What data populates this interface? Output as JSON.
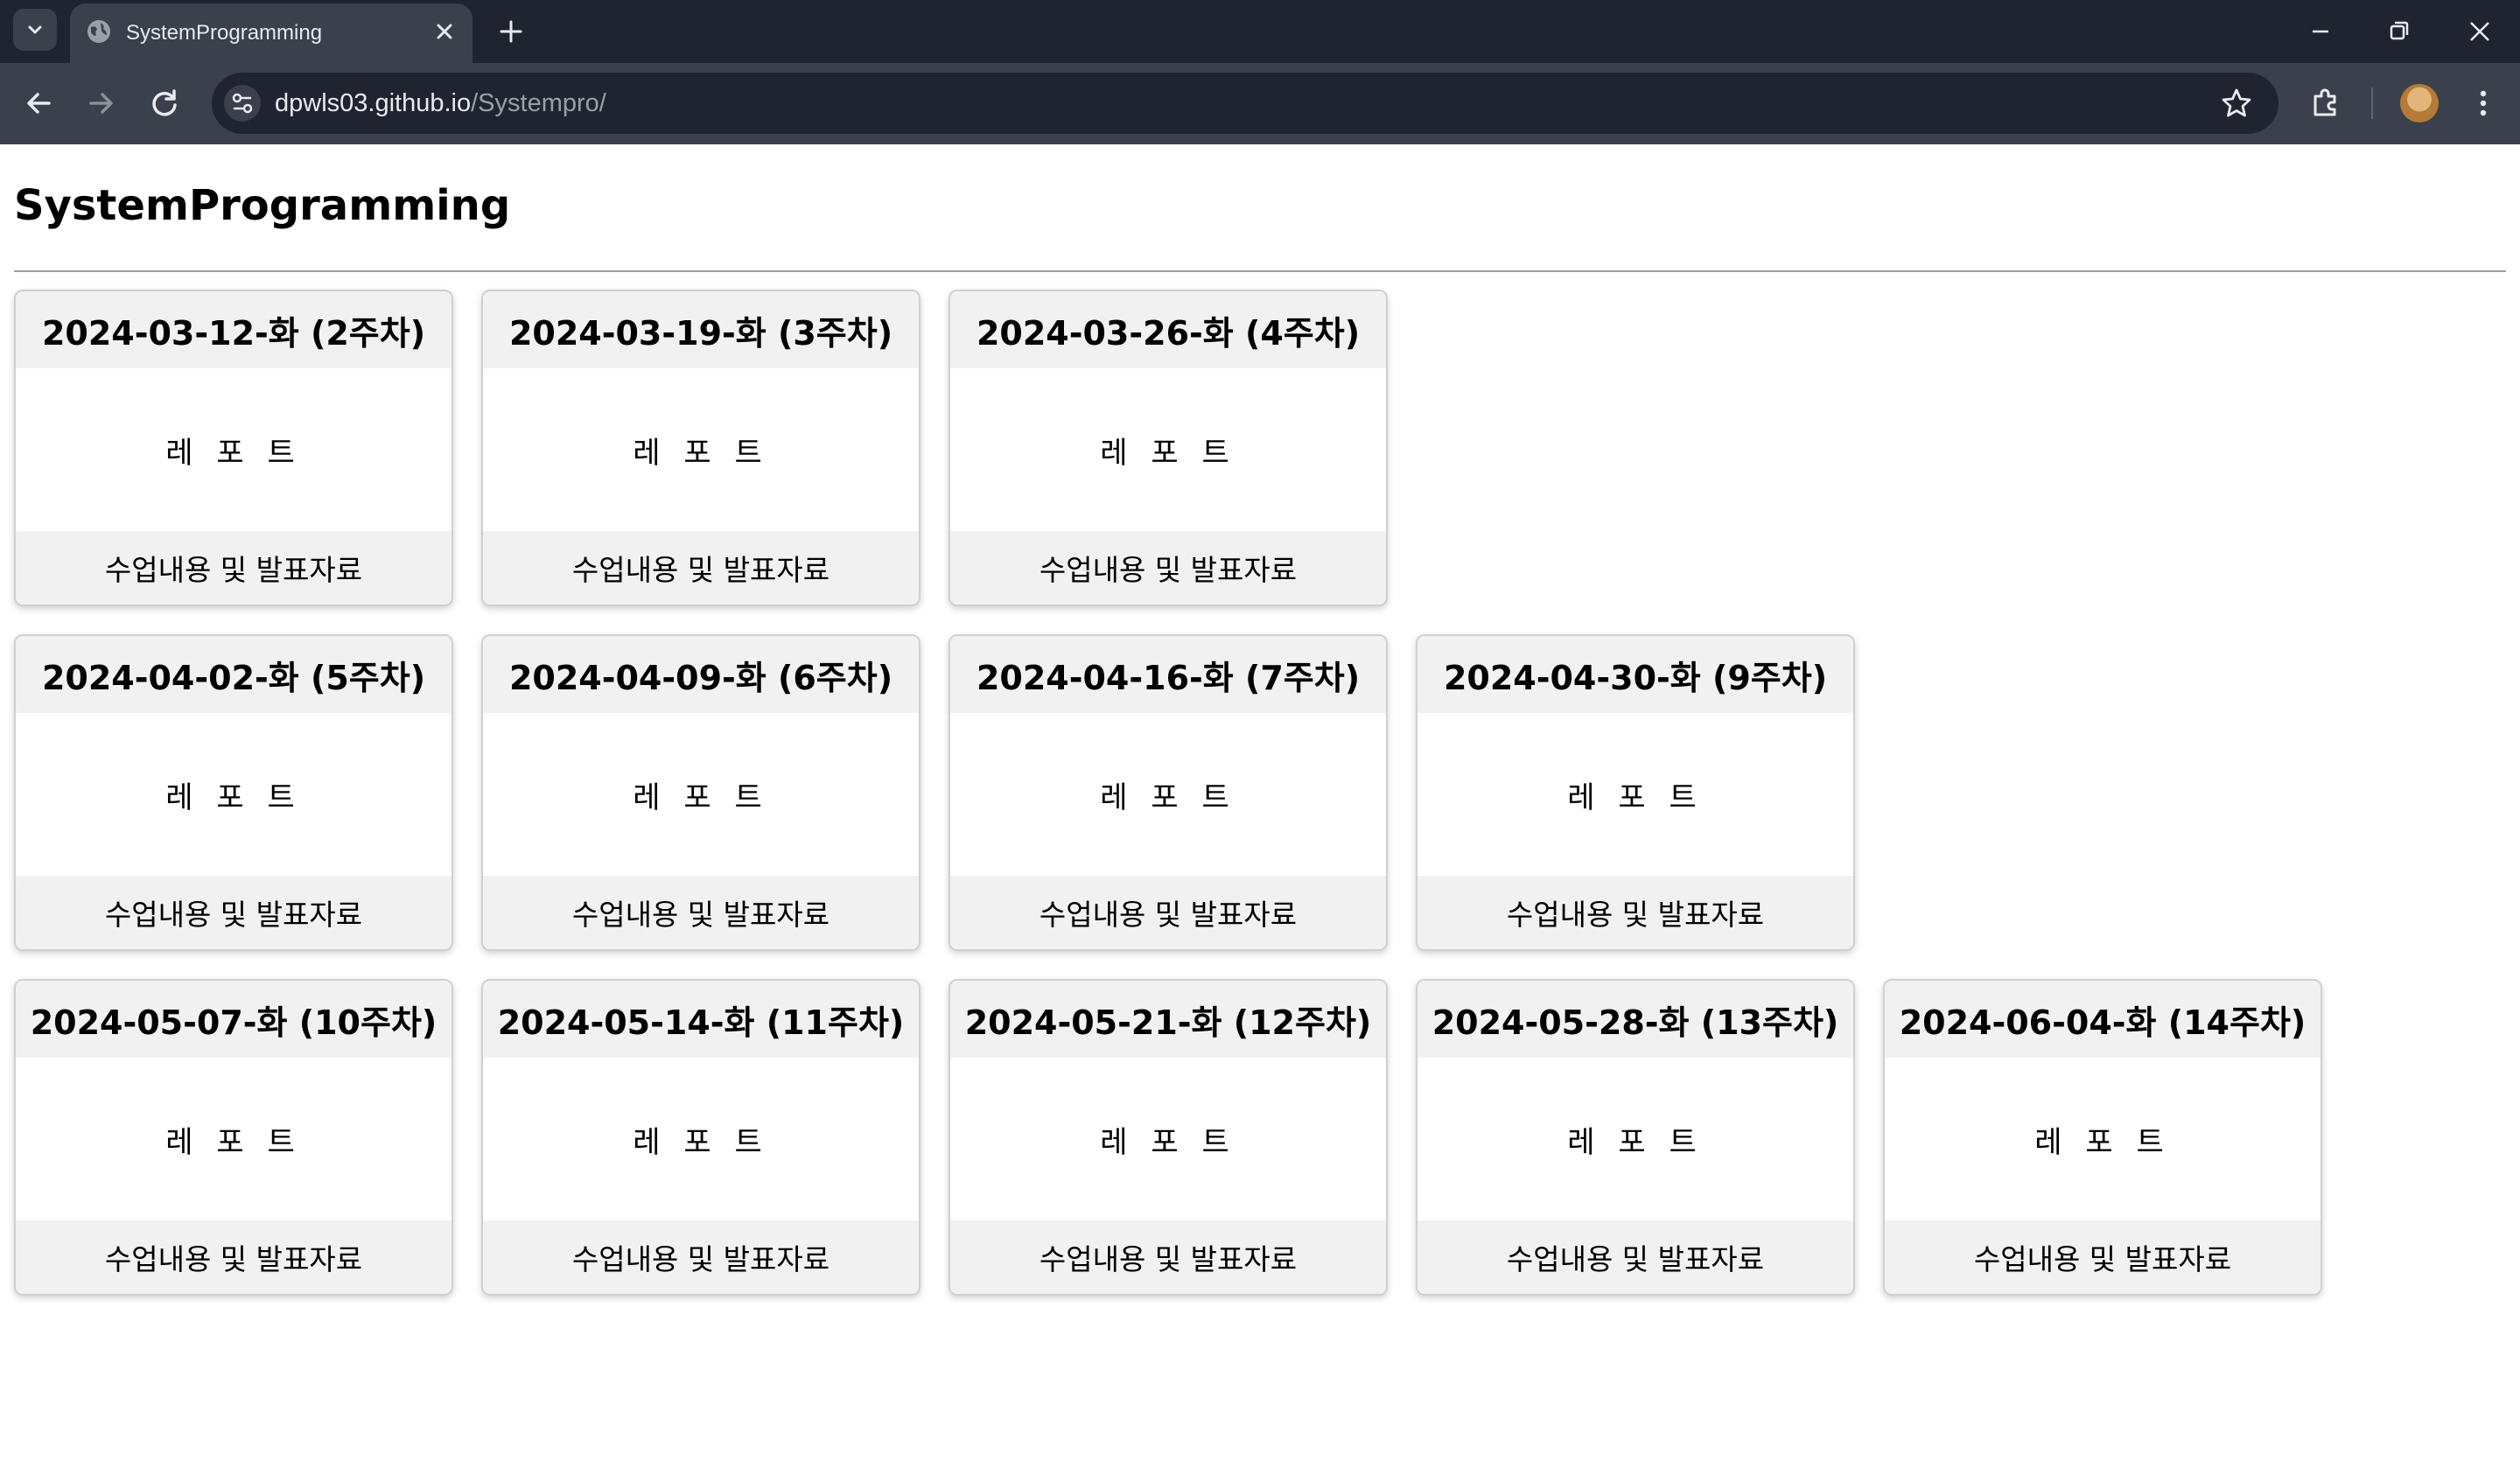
{
  "browser": {
    "tab_title": "SystemProgramming",
    "url_host": "dpwls03.github.io",
    "url_path": "/Systempro/"
  },
  "page": {
    "title": "SystemProgramming"
  },
  "rows": [
    [
      {
        "date": "2024-03-12-화 (2주차)",
        "report": "레 포 트",
        "materials": "수업내용 및 발표자료"
      },
      {
        "date": "2024-03-19-화 (3주차)",
        "report": "레 포 트",
        "materials": "수업내용 및 발표자료"
      },
      {
        "date": "2024-03-26-화 (4주차)",
        "report": "레 포 트",
        "materials": "수업내용 및 발표자료"
      }
    ],
    [
      {
        "date": "2024-04-02-화 (5주차)",
        "report": "레 포 트",
        "materials": "수업내용 및 발표자료"
      },
      {
        "date": "2024-04-09-화 (6주차)",
        "report": "레 포 트",
        "materials": "수업내용 및 발표자료"
      },
      {
        "date": "2024-04-16-화 (7주차)",
        "report": "레 포 트",
        "materials": "수업내용 및 발표자료"
      },
      {
        "date": "2024-04-30-화 (9주차)",
        "report": "레 포 트",
        "materials": "수업내용 및 발표자료"
      }
    ],
    [
      {
        "date": "2024-05-07-화 (10주차)",
        "report": "레 포 트",
        "materials": "수업내용 및 발표자료"
      },
      {
        "date": "2024-05-14-화 (11주차)",
        "report": "레 포 트",
        "materials": "수업내용 및 발표자료"
      },
      {
        "date": "2024-05-21-화 (12주차)",
        "report": "레 포 트",
        "materials": "수업내용 및 발표자료"
      },
      {
        "date": "2024-05-28-화 (13주차)",
        "report": "레 포 트",
        "materials": "수업내용 및 발표자료"
      },
      {
        "date": "2024-06-04-화 (14주차)",
        "report": "레 포 트",
        "materials": "수업내용 및 발표자료"
      }
    ]
  ]
}
